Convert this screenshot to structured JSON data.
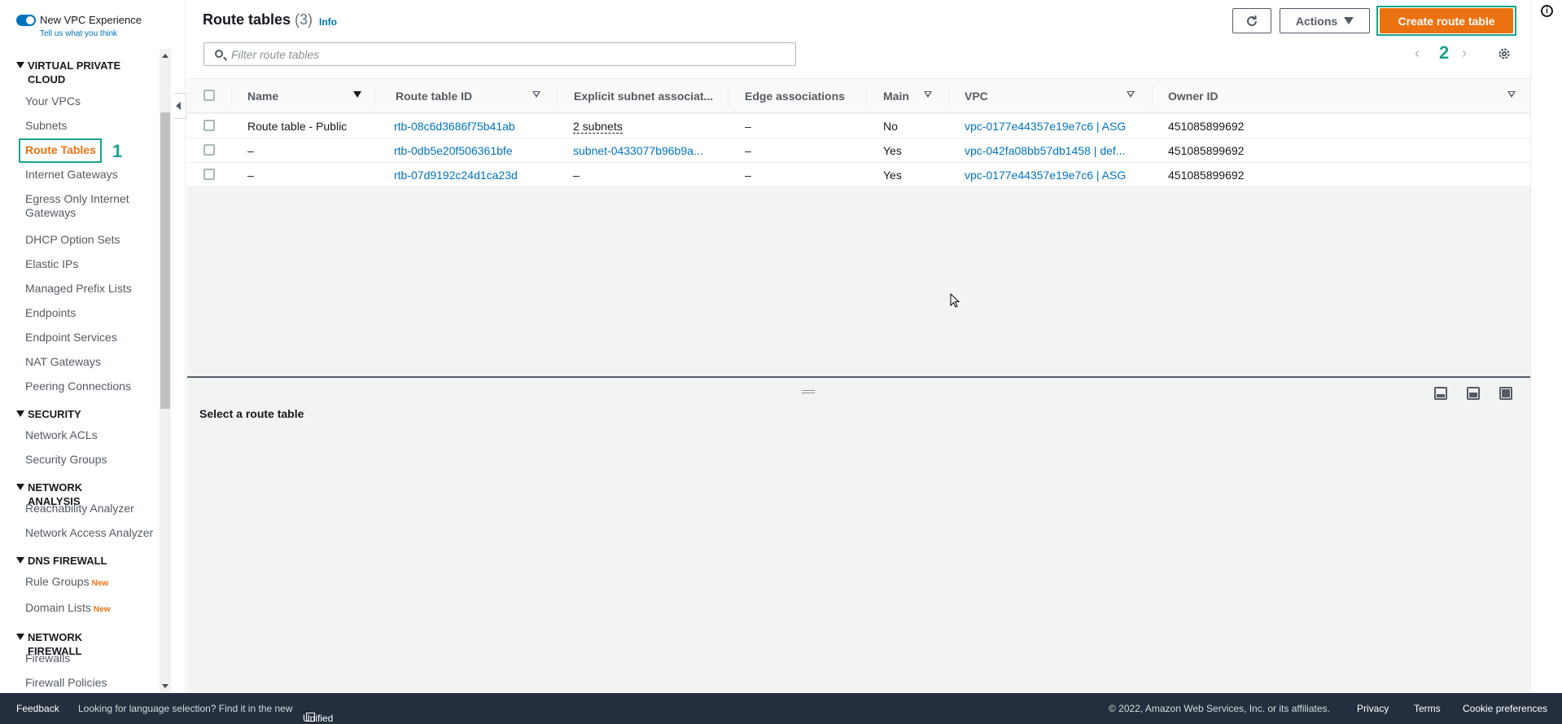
{
  "sidebar": {
    "toggle_title": "New VPC Experience",
    "feedback_link": "Tell us what you think",
    "sections": [
      {
        "title": "VIRTUAL PRIVATE CLOUD"
      },
      {
        "title": "SECURITY"
      },
      {
        "title": "NETWORK ANALYSIS"
      },
      {
        "title": "DNS FIREWALL"
      },
      {
        "title": "NETWORK FIREWALL"
      }
    ],
    "vpc_items": [
      "Your VPCs",
      "Subnets",
      "Route Tables",
      "Internet Gateways",
      "Egress Only Internet Gateways",
      "DHCP Option Sets",
      "Elastic IPs",
      "Managed Prefix Lists",
      "Endpoints",
      "Endpoint Services",
      "NAT Gateways",
      "Peering Connections"
    ],
    "security_items": [
      "Network ACLs",
      "Security Groups"
    ],
    "analysis_items": [
      "Reachability Analyzer",
      "Network Access Analyzer"
    ],
    "dns_items": [
      "Rule Groups",
      "Domain Lists"
    ],
    "firewall_items": [
      "Firewalls",
      "Firewall Policies"
    ],
    "new_tag": "New",
    "step_1": "1"
  },
  "header": {
    "title": "Route tables",
    "count": "(3)",
    "info": "Info",
    "filter_placeholder": "Filter route tables",
    "actions_label": "Actions",
    "create_label": "Create route table",
    "step_2": "2"
  },
  "table": {
    "columns": [
      "Name",
      "Route table ID",
      "Explicit subnet associat...",
      "Edge associations",
      "Main",
      "VPC",
      "Owner ID"
    ],
    "rows": [
      {
        "name": "Route table - Public",
        "id": "rtb-08c6d3686f75b41ab",
        "subnet": "2 subnets",
        "edge": "–",
        "main": "No",
        "vpc": "vpc-0177e44357e19e7c6 | ASG",
        "owner": "451085899692"
      },
      {
        "name": "–",
        "id": "rtb-0db5e20f506361bfe",
        "subnet": "subnet-0433077b96b9a...",
        "edge": "–",
        "main": "Yes",
        "vpc": "vpc-042fa08bb57db1458 | def...",
        "owner": "451085899692"
      },
      {
        "name": "–",
        "id": "rtb-07d9192c24d1ca23d",
        "subnet": "–",
        "edge": "–",
        "main": "Yes",
        "vpc": "vpc-0177e44357e19e7c6 | ASG",
        "owner": "451085899692"
      }
    ]
  },
  "split_panel": {
    "title": "Select a route table"
  },
  "footer": {
    "feedback": "Feedback",
    "language_msg": "Looking for language selection? Find it in the new",
    "unified_settings": "Unified Settings",
    "copyright": "© 2022, Amazon Web Services, Inc. or its affiliates.",
    "privacy": "Privacy",
    "terms": "Terms",
    "cookies": "Cookie preferences"
  },
  "colors": {
    "accent_orange": "#ec7211",
    "link_blue": "#0073bb",
    "annotation_teal": "#1aa38b",
    "footer_bg": "#232f3e"
  }
}
